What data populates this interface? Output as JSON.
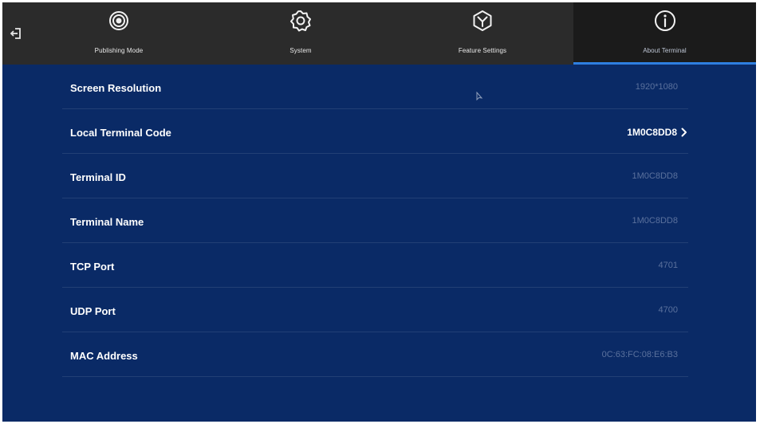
{
  "tabs": [
    {
      "label": "Publishing Mode",
      "icon": "publishing-mode-icon",
      "active": false
    },
    {
      "label": "System",
      "icon": "gear-icon",
      "active": false
    },
    {
      "label": "Feature Settings",
      "icon": "feature-settings-icon",
      "active": false
    },
    {
      "label": "About Terminal",
      "icon": "info-icon",
      "active": true
    }
  ],
  "rows": [
    {
      "label": "Screen Resolution",
      "value": "1920*1080"
    },
    {
      "label": "Local Terminal Code",
      "value": "1M0C8DD8"
    },
    {
      "label": "Terminal ID",
      "value": "1M0C8DD8"
    },
    {
      "label": "Terminal Name",
      "value": "1M0C8DD8"
    },
    {
      "label": "TCP Port",
      "value": "4701"
    },
    {
      "label": "UDP Port",
      "value": "4700"
    },
    {
      "label": "MAC Address",
      "value": "0C:63:FC:08:E6:B3"
    }
  ],
  "colors": {
    "background": "#0a2a66",
    "topbar": "#2b2b2b",
    "active_tab": "#1b1b1b",
    "accent": "#2f7fe0"
  }
}
